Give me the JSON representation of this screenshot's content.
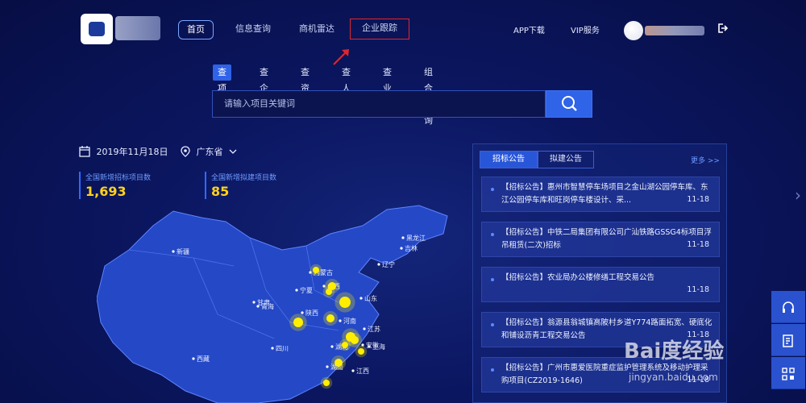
{
  "nav": {
    "items": [
      "首页",
      "信息查询",
      "商机雷达",
      "企业跟踪"
    ],
    "app_download": "APP下载",
    "vip": "VIP服务",
    "logout_icon": "logout-icon"
  },
  "search": {
    "tabs": [
      "查项目",
      "查企业",
      "查资质",
      "查人员",
      "查业绩",
      "组合查询"
    ],
    "placeholder": "请输入项目关键词",
    "search_icon": "search-icon"
  },
  "dashboard": {
    "date": "2019年11月18日",
    "region": "广东省",
    "stats": [
      {
        "label": "全国新增招标项目数",
        "value": "1,693"
      },
      {
        "label": "全国新增拟建项目数",
        "value": "85"
      }
    ]
  },
  "map": {
    "labels": [
      "新疆",
      "西藏",
      "内蒙古",
      "黑龙江",
      "吉林",
      "辽宁",
      "宁夏",
      "山东",
      "甘肃",
      "青海",
      "陕西",
      "山西",
      "河南",
      "湖北",
      "安徽",
      "江苏",
      "上海",
      "四川",
      "湖南",
      "江西"
    ],
    "hotspot_color": "#ffee00"
  },
  "notices": {
    "tabs": [
      "招标公告",
      "拟建公告"
    ],
    "more": "更多 >>",
    "items": [
      {
        "text": "【招标公告】惠州市智慧停车场项目之金山湖公园停车库、东江公园停车库和旺岗停车楼设计、采...",
        "date": "11-18"
      },
      {
        "text": "【招标公告】中铁二局集团有限公司广汕铁路GSSG4标项目浮吊租赁(二次)招标",
        "date": "11-18"
      },
      {
        "text": "【招标公告】农业局办公楼修缮工程交易公告",
        "date": "11-18"
      },
      {
        "text": "【招标公告】翁源县翁城镇高陂村乡道Y774路面拓宽、硬底化和铺设沥青工程交易公告",
        "date": "11-18"
      },
      {
        "text": "【招标公告】广州市惠爱医院重症监护管理系统及移动护理采购项目(CZ2019-1646)",
        "date": "11-18"
      }
    ]
  },
  "watermark": {
    "main": "Bai度经验",
    "sub": "jingyan.baidu.com"
  },
  "side_tools": [
    "headset-icon",
    "edit-icon",
    "qrcode-icon"
  ]
}
